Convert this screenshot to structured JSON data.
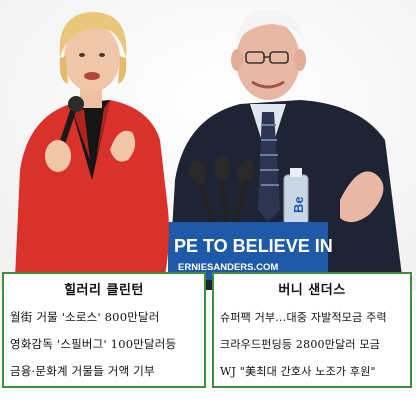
{
  "photo": {
    "podium_sign": "PE TO BELIEVE IN",
    "podium_url": "ERNIESANDERS.COM",
    "bottle_label": "Be"
  },
  "left_caption": {
    "title": "힐러리 클린턴",
    "lines": [
      "월街 거물 '소로스' 800만달러",
      "영화감독 '스필버그' 100만달러등",
      "금융·문화계 거물들 거액 기부"
    ]
  },
  "right_caption": {
    "title": "버니 샌더스",
    "lines": [
      "슈퍼팩 거부…대중 자발적모금 주력",
      "크라우드펀딩등  2800만달러 모금",
      "WJ \"美최대 간호사 노조가 후원\""
    ]
  },
  "colors": {
    "box_border": "#3f8f3c",
    "hillary_jacket": "#d8322a",
    "podium_blue": "#1f5aa8"
  }
}
